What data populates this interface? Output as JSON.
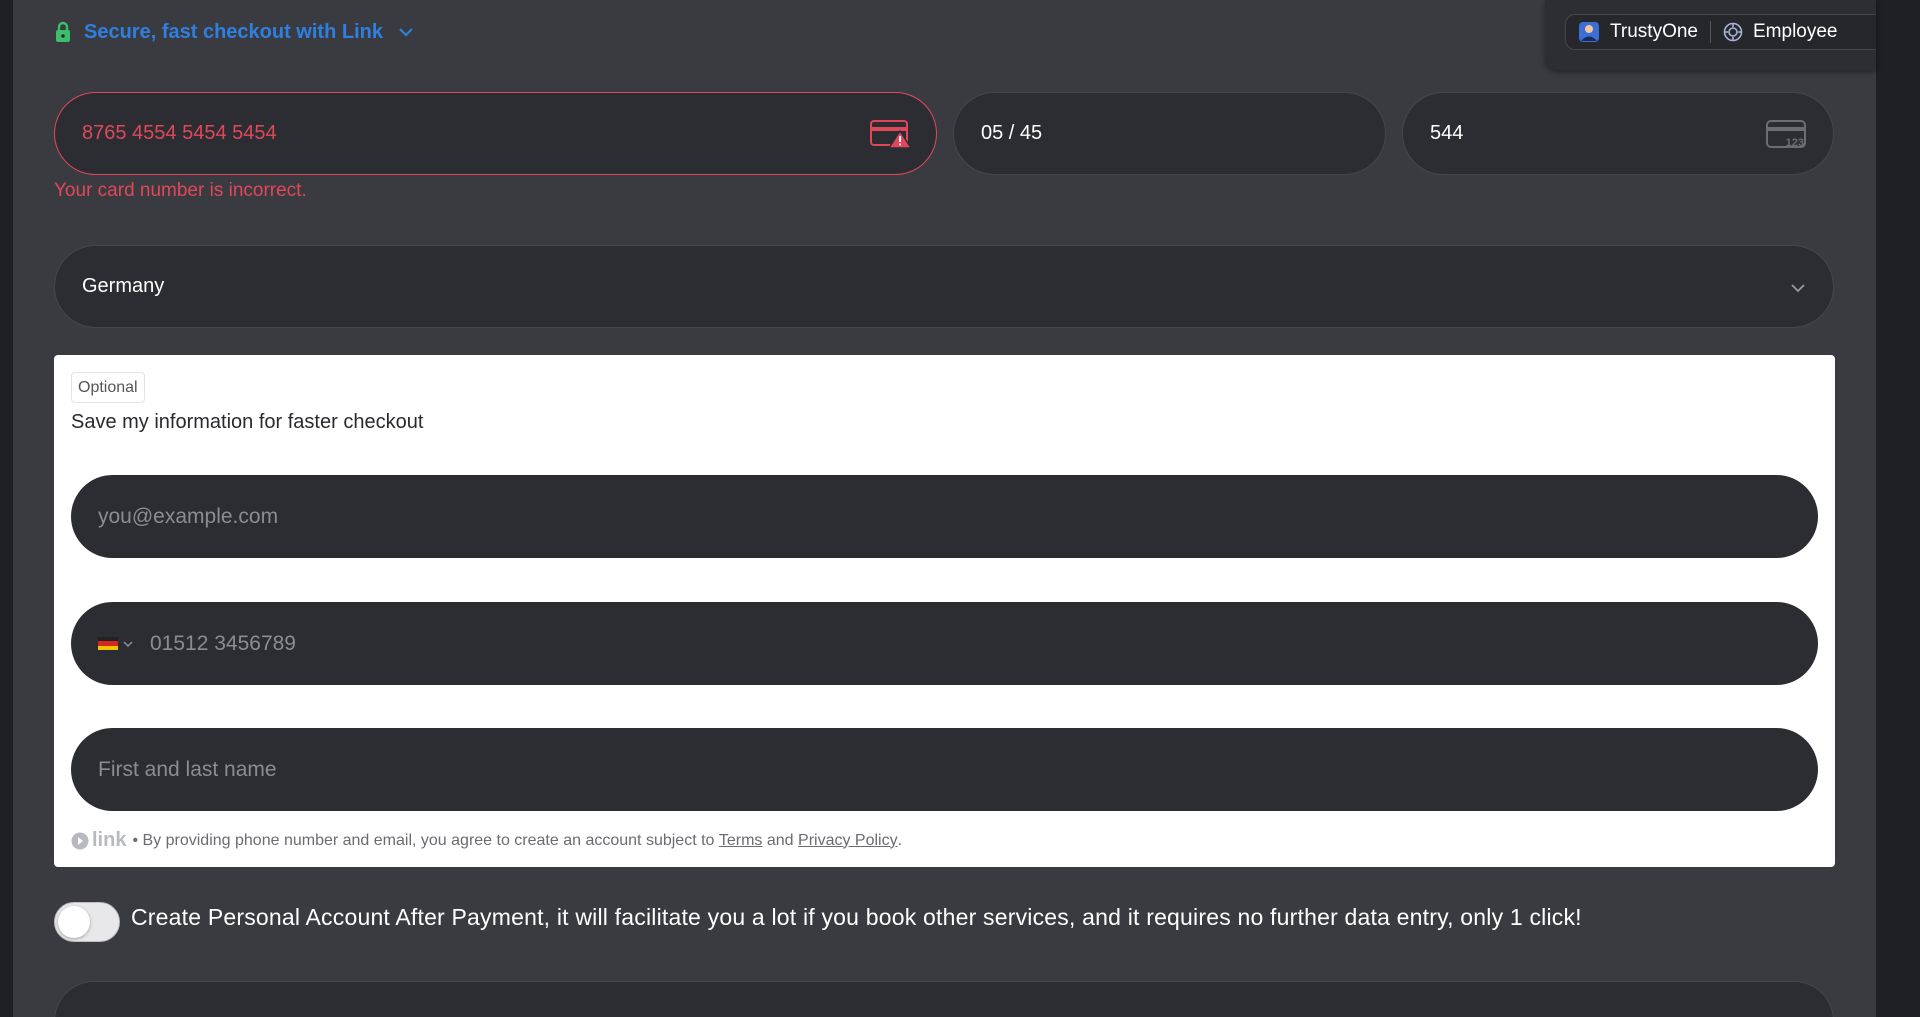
{
  "link_header": {
    "label": "Secure, fast checkout with Link",
    "icon": "lock-icon",
    "color": "#2f7fe0"
  },
  "popup": {
    "app_name": "TrustyOne",
    "role": "Employee"
  },
  "card": {
    "number": "8765 4554 5454 5454",
    "expiry": "05 / 45",
    "cvc": "544",
    "error": "Your card number is incorrect.",
    "error_color": "#e0485a"
  },
  "country": {
    "selected": "Germany"
  },
  "save_panel": {
    "badge": "Optional",
    "title": "Save my information for faster checkout",
    "email_placeholder": "you@example.com",
    "phone_placeholder": "01512 3456789",
    "name_placeholder": "First and last name",
    "footer": {
      "logo": "link",
      "bullet": "•",
      "text_before": " By providing phone number and email, you agree to create an account subject to ",
      "terms": "Terms",
      "and": " and ",
      "privacy": "Privacy Policy",
      "end": "."
    }
  },
  "toggle": {
    "checked": false,
    "label": "Create Personal Account After Payment, it will facilitate you a lot if you book other services, and it requires no further data entry, only 1 click!"
  }
}
